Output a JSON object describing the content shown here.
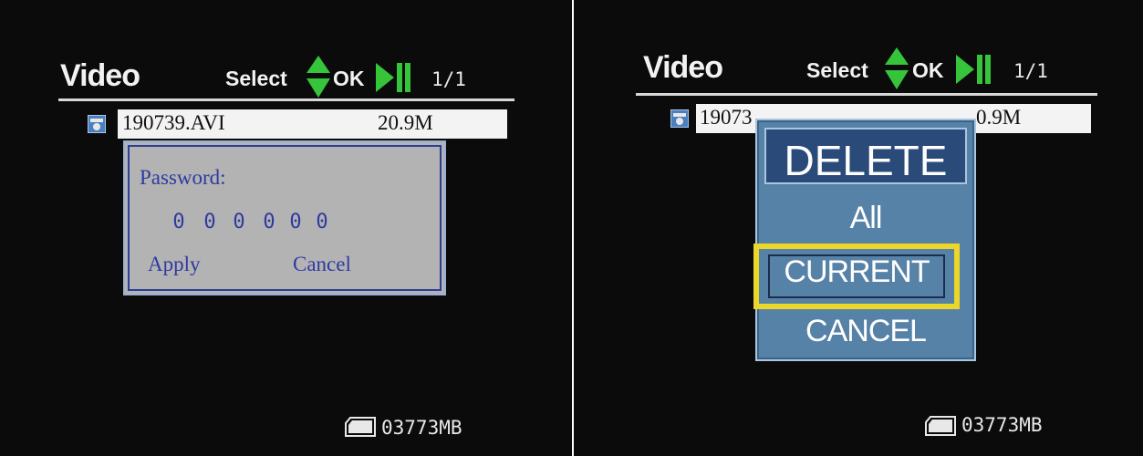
{
  "left_screen": {
    "title": "Video",
    "header": {
      "select_label": "Select",
      "ok_label": "OK",
      "page": "1/1"
    },
    "file": {
      "name": "190739.AVI",
      "size": "20.9M"
    },
    "password_dialog": {
      "label": "Password:",
      "digits": [
        "0",
        "0",
        "0",
        "0",
        "0",
        "0"
      ],
      "apply_label": "Apply",
      "cancel_label": "Cancel"
    },
    "storage": "03773MB"
  },
  "right_screen": {
    "title": "Video",
    "header": {
      "select_label": "Select",
      "ok_label": "OK",
      "page": "1/1"
    },
    "file": {
      "name_visible": "19073",
      "size_visible": "0.9M"
    },
    "delete_menu": {
      "title": "DELETE",
      "options": [
        "All",
        "CURRENT",
        "CANCEL"
      ],
      "selected": "CURRENT"
    },
    "storage": "03773MB"
  },
  "colors": {
    "screen_bg": "#0b0b0b",
    "arrow_green": "#36c43a",
    "dialog_gray": "#b3b3b3",
    "dialog_text_blue": "#2e3aa0",
    "menu_blue": "#5782a8",
    "menu_header": "#2a4a7a",
    "highlight_yellow": "#ecd728"
  },
  "icons": [
    "up-down-arrow-icon",
    "play-pause-icon",
    "video-file-icon",
    "sd-card-icon"
  ]
}
